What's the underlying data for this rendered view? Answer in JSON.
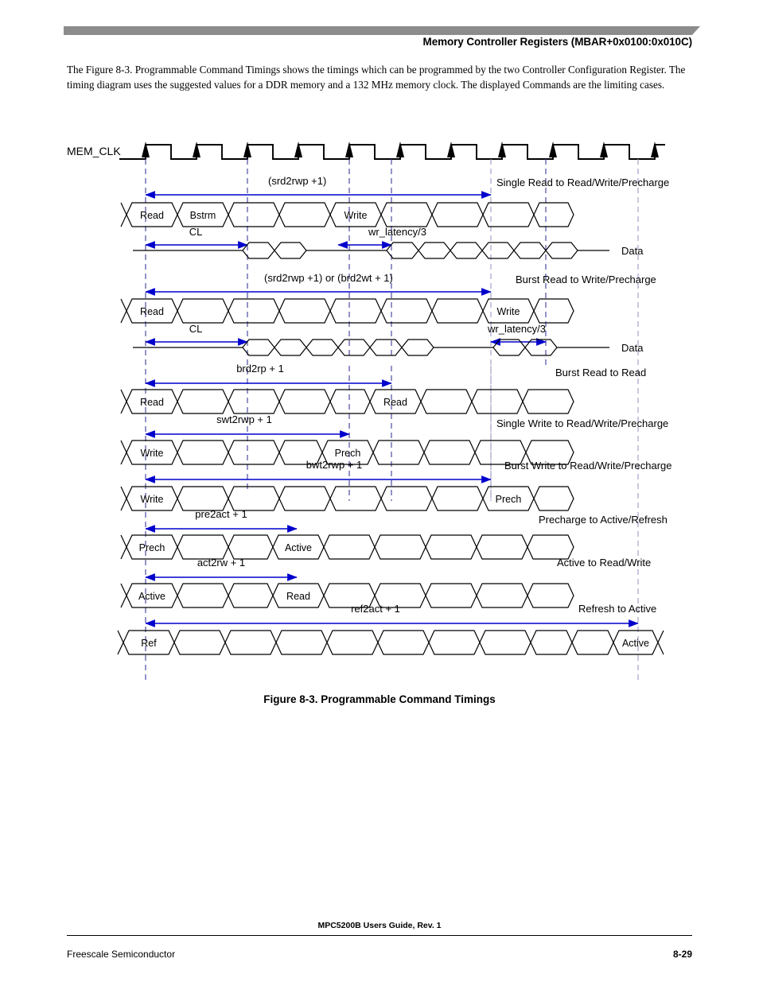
{
  "header": {
    "title": "Memory Controller Registers (MBAR+0x0100:0x010C)"
  },
  "intro": {
    "paragraph": "The Figure 8-3. Programmable Command Timings shows the timings which can be programmed by the two Controller Configuration Register. The timing diagram uses the suggested values for a DDR memory and a 132 MHz memory clock. The displayed Commands are the limiting cases."
  },
  "figure": {
    "caption": "Figure 8-3. Programmable Command Timings",
    "clock_label": "MEM_CLK",
    "clock_cycles": 12,
    "data_label_1": "Data",
    "data_label_2": "Data",
    "rows": [
      {
        "name": "single-read",
        "timing_label": "(srd2rwp +1)",
        "description": "Single Read to Read/Write/Precharge",
        "commands": [
          "Read",
          "Bstrm",
          "Write"
        ],
        "sub_label_left": "CL",
        "sub_label_right": "wr_latency/3"
      },
      {
        "name": "burst-read-write",
        "timing_label": "(srd2rwp +1) or (brd2wt + 1)",
        "description": "Burst Read to Write/Precharge",
        "commands": [
          "Read",
          "Write"
        ],
        "sub_label_left": "CL",
        "sub_label_right": "wr_latency/3"
      },
      {
        "name": "burst-read-read",
        "timing_label": "brd2rp + 1",
        "description": "Burst Read to Read",
        "commands": [
          "Read",
          "Read"
        ]
      },
      {
        "name": "single-write",
        "timing_label": "swt2rwp + 1",
        "description": "Single Write to Read/Write/Precharge",
        "commands": [
          "Write",
          "Prech"
        ]
      },
      {
        "name": "burst-write",
        "timing_label": "bwt2rwp + 1",
        "description": "Burst Write to Read/Write/Precharge",
        "commands": [
          "Write",
          "Prech"
        ]
      },
      {
        "name": "precharge-active",
        "timing_label": "pre2act + 1",
        "description": "Precharge to Active/Refresh",
        "commands": [
          "Prech",
          "Active"
        ]
      },
      {
        "name": "active-readwrite",
        "timing_label": "act2rw + 1",
        "description": "Active to Read/Write",
        "commands": [
          "Active",
          "Read"
        ]
      },
      {
        "name": "refresh-active",
        "timing_label": "ref2act + 1",
        "description": "Refresh to Active",
        "commands": [
          "Ref",
          "Active"
        ]
      }
    ]
  },
  "footer": {
    "doc_title": "MPC5200B Users Guide, Rev. 1",
    "company": "Freescale Semiconductor",
    "page": "8-29"
  },
  "colors": {
    "arrow": "#0000cc",
    "guide": "#3b3b9c",
    "header_bar": "#8c8c8c",
    "text": "#000000"
  }
}
